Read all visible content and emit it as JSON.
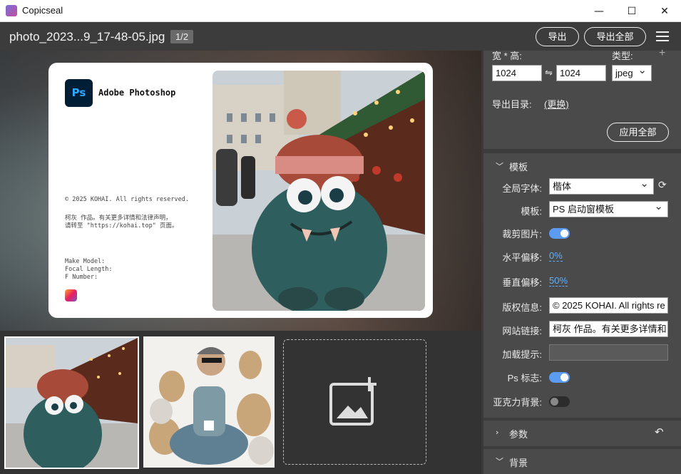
{
  "window": {
    "title": "Copicseal",
    "minimize": "—",
    "maximize": "☐",
    "close": "✕"
  },
  "header": {
    "filename": "photo_2023...9_17-48-05.jpg",
    "page": "1/2",
    "export": "导出",
    "export_all": "导出全部"
  },
  "card": {
    "app_name": "Adobe Photoshop",
    "ps_text": "Ps",
    "copyright": "© 2025 KOHAI. All rights reserved.",
    "desc_line1": "柯灰 作品。有关更多详情和法律声明，",
    "desc_line2": "请转至 \"https://kohai.top\" 页面。",
    "exif_model": "Make Model:",
    "exif_focal": "Focal Length:",
    "exif_fnum": "F Number:"
  },
  "export_panel": {
    "size_label": "宽 * 高:",
    "type_label": "类型:",
    "width": "1024",
    "height": "1024",
    "link_icon": "⇋",
    "type_value": "jpeg",
    "dir_label": "导出目录:",
    "dir_change": "(更换)",
    "apply_all": "应用全部",
    "add_icon": "+"
  },
  "template_section": {
    "title": "模板",
    "font_label": "全局字体:",
    "font_value": "楷体",
    "template_label": "模板:",
    "template_value": "PS 启动窗模板",
    "crop_label": "裁剪图片:",
    "crop_on": true,
    "hoffset_label": "水平偏移:",
    "hoffset_value": "0%",
    "voffset_label": "垂直偏移:",
    "voffset_value": "50%",
    "copyright_label": "版权信息:",
    "copyright_value": "© 2025 KOHAI. All rights re",
    "site_label": "网站链接:",
    "site_value": "柯灰 作品。有关更多详情和",
    "loading_label": "加载提示:",
    "loading_value": "",
    "ps_badge_label": "Ps 标志:",
    "ps_badge_on": true,
    "acrylic_label": "亚克力背景:",
    "acrylic_on": false
  },
  "params_section": {
    "title": "参数"
  },
  "bg_section": {
    "title": "背景"
  },
  "colors": {
    "accent": "#5b9bf2",
    "link": "#5fb0ff",
    "panel": "#4a4a4a"
  }
}
